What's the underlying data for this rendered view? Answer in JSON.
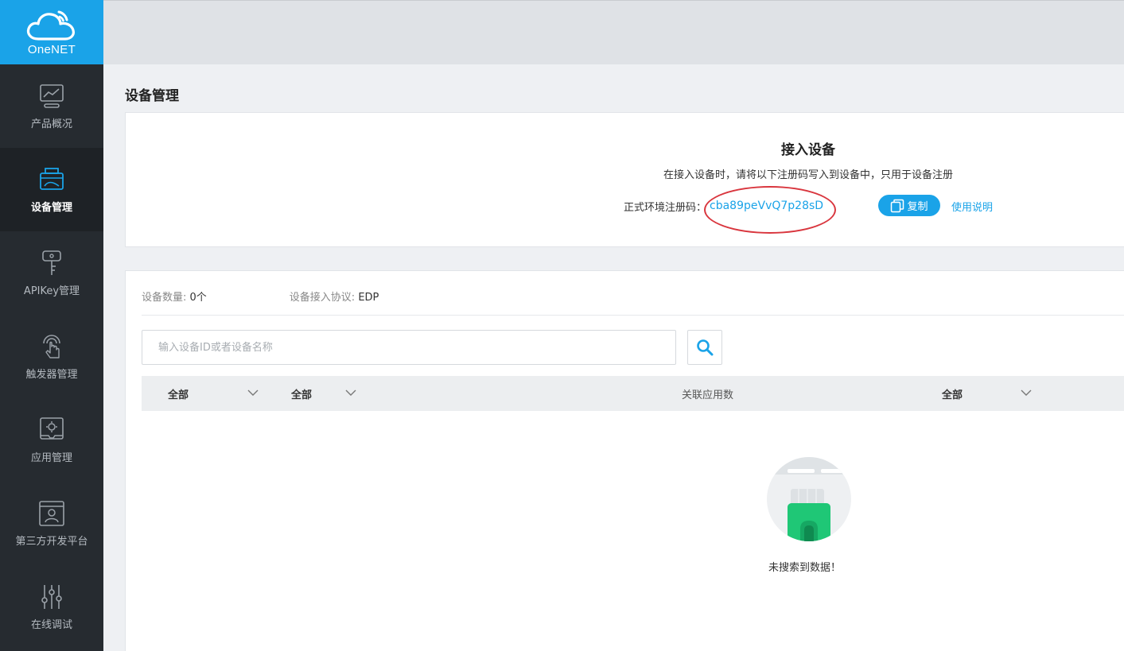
{
  "brand": {
    "name": "OneNET",
    "color": "#1aa3e8"
  },
  "sidebar": {
    "items": [
      {
        "label": "产品概况",
        "icon": "chart-monitor-icon",
        "active": false
      },
      {
        "label": "设备管理",
        "icon": "device-icon",
        "active": true
      },
      {
        "label": "APIKey管理",
        "icon": "key-icon",
        "active": false
      },
      {
        "label": "触发器管理",
        "icon": "touch-trigger-icon",
        "active": false
      },
      {
        "label": "应用管理",
        "icon": "app-gear-icon",
        "active": false
      },
      {
        "label": "第三方开发平台",
        "icon": "third-party-user-icon",
        "active": false
      },
      {
        "label": "在线调试",
        "icon": "sliders-icon",
        "active": false
      }
    ]
  },
  "page": {
    "title": "设备管理"
  },
  "access": {
    "title": "接入设备",
    "description": "在接入设备时，请将以下注册码写入到设备中，只用于设备注册",
    "reg_label": "正式环境注册码：",
    "reg_code": "cba89peVvQ7p28sD",
    "copy_label": "复制",
    "help_label": "使用说明"
  },
  "devices": {
    "count_label": "设备数量: ",
    "count_value": "0个",
    "protocol_label": "设备接入协议: ",
    "protocol_value": "EDP",
    "search_placeholder": "输入设备ID或者设备名称",
    "columns": [
      {
        "label": "全部",
        "dropdown": true
      },
      {
        "label": "全部",
        "dropdown": true
      },
      {
        "label": "关联应用数",
        "dropdown": false
      },
      {
        "label": "全部",
        "dropdown": true
      }
    ],
    "empty_text": "未搜索到数据！"
  },
  "colors": {
    "accent": "#1aa3e8",
    "sidebar_bg": "#262b30",
    "highlight_circle": "#d9363e",
    "empty_icon_green": "#1fc776"
  }
}
